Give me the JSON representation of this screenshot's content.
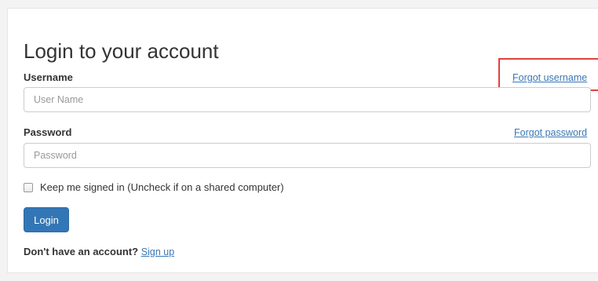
{
  "login_form": {
    "title": "Login to your account",
    "username_label": "Username",
    "forgot_username": "Forgot username",
    "username_placeholder": "User Name",
    "username_value": "",
    "password_label": "Password",
    "forgot_password": "Forgot password",
    "password_placeholder": "Password",
    "password_value": "",
    "remember_label": "Keep me signed in (Uncheck if on a shared computer)",
    "remember_checked": false,
    "login_button": "Login",
    "signup_prompt": "Don't have an account?",
    "signup_link": "Sign up"
  },
  "colors": {
    "primary_button": "#3376b6",
    "link": "#3a77b5",
    "highlight": "#e0413c"
  }
}
